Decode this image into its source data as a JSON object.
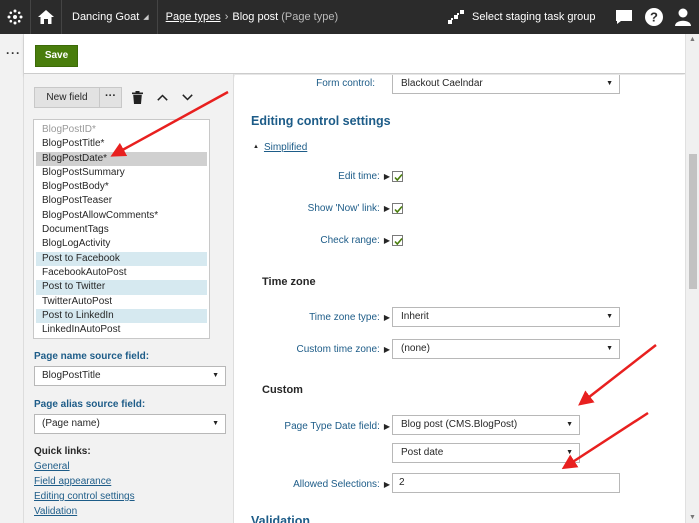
{
  "topbar": {
    "site_name": "Dancing Goat",
    "breadcrumb_link": "Page types",
    "breadcrumb_current": "Blog post",
    "breadcrumb_type": "(Page type)",
    "staging_label": "Select staging task group"
  },
  "toolbar": {
    "save_label": "Save",
    "new_field_label": "New field",
    "more_label": "···"
  },
  "fields": {
    "items": [
      {
        "label": "BlogPostID*",
        "state": "system"
      },
      {
        "label": "BlogPostTitle*",
        "state": "normal"
      },
      {
        "label": "BlogPostDate*",
        "state": "selected"
      },
      {
        "label": "BlogPostSummary",
        "state": "normal"
      },
      {
        "label": "BlogPostBody*",
        "state": "normal"
      },
      {
        "label": "BlogPostTeaser",
        "state": "normal"
      },
      {
        "label": "BlogPostAllowComments*",
        "state": "normal"
      },
      {
        "label": "DocumentTags",
        "state": "normal"
      },
      {
        "label": "BlogLogActivity",
        "state": "normal"
      },
      {
        "label": "Post to Facebook",
        "state": "highlight"
      },
      {
        "label": "FacebookAutoPost",
        "state": "normal"
      },
      {
        "label": "Post to Twitter",
        "state": "highlight"
      },
      {
        "label": "TwitterAutoPost",
        "state": "normal"
      },
      {
        "label": "Post to LinkedIn",
        "state": "highlight"
      },
      {
        "label": "LinkedInAutoPost",
        "state": "normal"
      }
    ]
  },
  "left": {
    "page_name_label": "Page name source field:",
    "page_name_value": "BlogPostTitle",
    "page_alias_label": "Page alias source field:",
    "page_alias_value": "(Page name)",
    "quick_links_title": "Quick links:",
    "quick_links": [
      "General",
      "Field appearance",
      "Editing control settings",
      "Validation"
    ]
  },
  "main": {
    "form_control_label": "Form control:",
    "form_control_value": "Blackout Caelndar",
    "editing_heading": "Editing control settings",
    "simplified_label": "Simplified",
    "edit_time_label": "Edit time:",
    "show_now_label": "Show 'Now' link:",
    "check_range_label": "Check range:",
    "time_zone_heading": "Time zone",
    "time_zone_type_label": "Time zone type:",
    "time_zone_type_value": "Inherit",
    "custom_time_zone_label": "Custom time zone:",
    "custom_time_zone_value": "(none)",
    "custom_heading": "Custom",
    "page_type_date_label": "Page Type Date field:",
    "page_type_value": "Blog post (CMS.BlogPost)",
    "date_field_value": "Post date",
    "allowed_selections_label": "Allowed Selections:",
    "allowed_selections_value": "2",
    "validation_heading": "Validation"
  },
  "colors": {
    "topbar": "#2b2b2b",
    "save": "#497d0c",
    "label_blue": "#1d5c88",
    "annotation_arrow": "#e8201f"
  },
  "icons": [
    "kentico-logo-icon",
    "home-icon",
    "staging-icon",
    "chat-icon",
    "help-icon",
    "user-icon",
    "delete-icon",
    "chevron-up-icon",
    "chevron-down-icon"
  ]
}
